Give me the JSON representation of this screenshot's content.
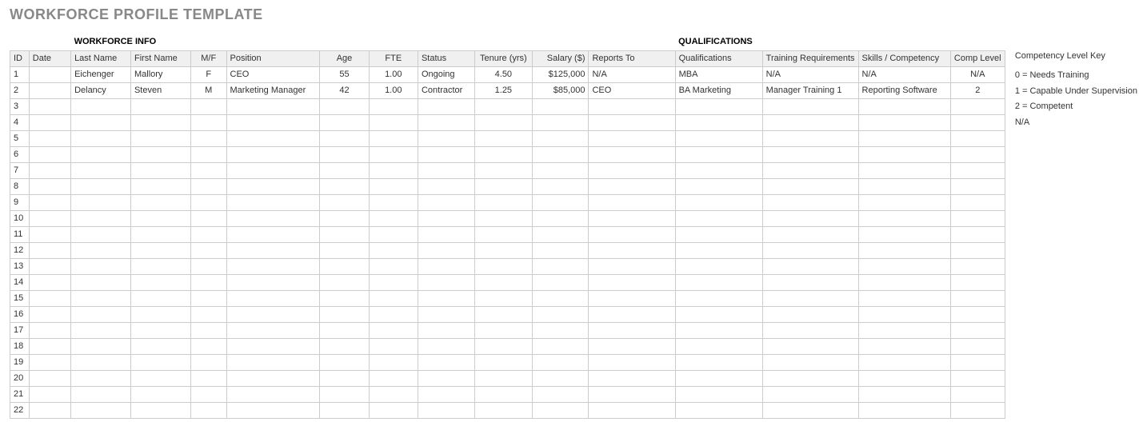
{
  "title": "WORKFORCE PROFILE TEMPLATE",
  "sections": {
    "info": "WORKFORCE INFO",
    "qual": "QUALIFICATIONS"
  },
  "headers": {
    "id": "ID",
    "date": "Date",
    "last": "Last Name",
    "first": "First Name",
    "mf": "M/F",
    "pos": "Position",
    "age": "Age",
    "fte": "FTE",
    "stat": "Status",
    "ten": "Tenure (yrs)",
    "sal": "Salary ($)",
    "rep": "Reports To",
    "qual": "Qualifications",
    "train": "Training Requirements",
    "skill": "Skills / Competency",
    "comp": "Comp Level"
  },
  "rows": [
    {
      "id": "1",
      "date": "",
      "last": "Eichenger",
      "first": "Mallory",
      "mf": "F",
      "pos": "CEO",
      "age": "55",
      "fte": "1.00",
      "stat": "Ongoing",
      "ten": "4.50",
      "sal": "$125,000",
      "rep": "N/A",
      "qual": "MBA",
      "train": "N/A",
      "skill": "N/A",
      "comp": "N/A"
    },
    {
      "id": "2",
      "date": "",
      "last": "Delancy",
      "first": "Steven",
      "mf": "M",
      "pos": "Marketing Manager",
      "age": "42",
      "fte": "1.00",
      "stat": "Contractor",
      "ten": "1.25",
      "sal": "$85,000",
      "rep": "CEO",
      "qual": "BA Marketing",
      "train": "Manager Training 1",
      "skill": "Reporting Software",
      "comp": "2"
    },
    {
      "id": "3"
    },
    {
      "id": "4"
    },
    {
      "id": "5"
    },
    {
      "id": "6"
    },
    {
      "id": "7"
    },
    {
      "id": "8"
    },
    {
      "id": "9"
    },
    {
      "id": "10"
    },
    {
      "id": "11"
    },
    {
      "id": "12"
    },
    {
      "id": "13"
    },
    {
      "id": "14"
    },
    {
      "id": "15"
    },
    {
      "id": "16"
    },
    {
      "id": "17"
    },
    {
      "id": "18"
    },
    {
      "id": "19"
    },
    {
      "id": "20"
    },
    {
      "id": "21"
    },
    {
      "id": "22"
    }
  ],
  "key": {
    "title": "Competency Level Key",
    "items": [
      "0 = Needs Training",
      "1 = Capable Under Supervision",
      "2 = Competent",
      "N/A"
    ]
  }
}
